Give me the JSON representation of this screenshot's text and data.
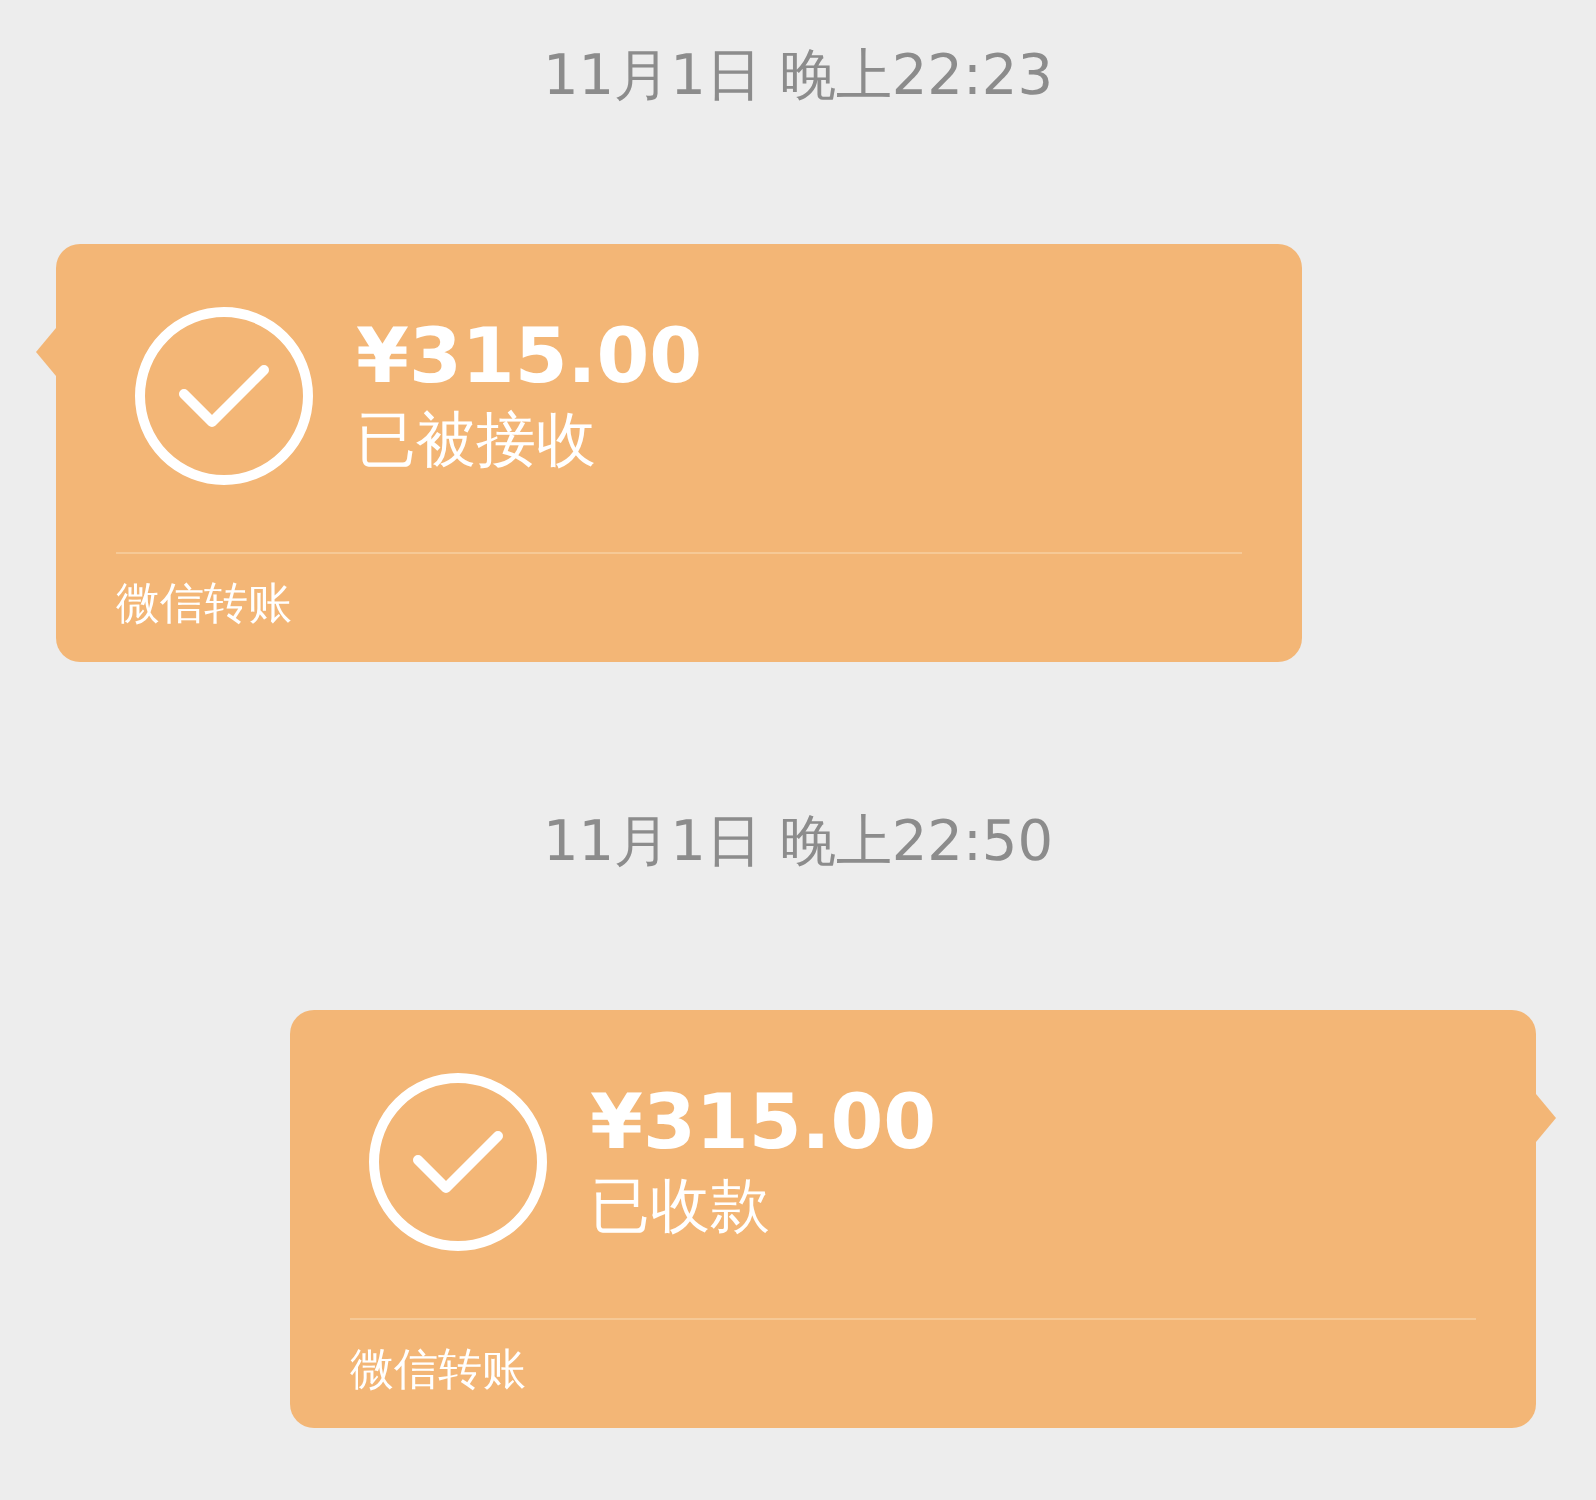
{
  "messages": [
    {
      "timestamp": "11月1日 晚上22:23",
      "kind": "incoming",
      "amount": "¥315.00",
      "status": "已被接收",
      "footer": "微信转账"
    },
    {
      "timestamp": "11月1日 晚上22:50",
      "kind": "outgoing",
      "amount": "¥315.00",
      "status": "已收款",
      "footer": "微信转账"
    }
  ]
}
